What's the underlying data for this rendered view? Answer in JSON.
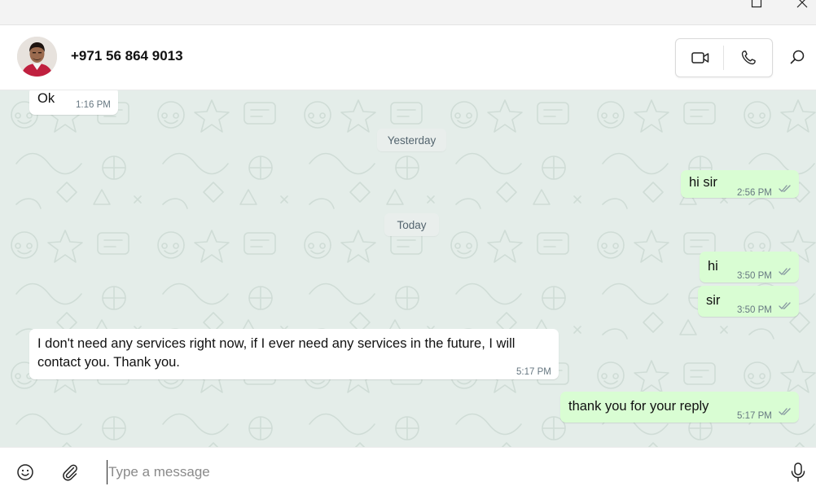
{
  "contact": {
    "name": "+971 56 864 9013"
  },
  "header": {
    "video_icon": "video-camera-icon",
    "voice_icon": "phone-icon",
    "search_icon": "search-icon"
  },
  "messages": [
    {
      "direction": "in",
      "text": "Ok",
      "time": "1:16 PM"
    },
    {
      "type": "date",
      "label": "Yesterday"
    },
    {
      "direction": "out",
      "text": "hi sir",
      "time": "2:56 PM",
      "status": "read"
    },
    {
      "type": "date",
      "label": "Today"
    },
    {
      "direction": "out",
      "text": "hi",
      "time": "3:50 PM",
      "status": "read"
    },
    {
      "direction": "out",
      "text": "sir",
      "time": "3:50 PM",
      "status": "read"
    },
    {
      "direction": "in",
      "text_line1": "I don't need any services right now, if I ever need any services in the future, I will",
      "text_line2": "contact you. Thank you.",
      "time": "5:17 PM"
    },
    {
      "direction": "out",
      "text": "thank you for your reply",
      "time": "5:17 PM",
      "status": "read"
    }
  ],
  "composer": {
    "placeholder": "Type a message",
    "value": ""
  },
  "colors": {
    "outgoing_bubble": "#d9fdd3",
    "incoming_bubble": "#ffffff",
    "chat_background": "#e4ede9",
    "read_ticks": "#8696a0"
  }
}
